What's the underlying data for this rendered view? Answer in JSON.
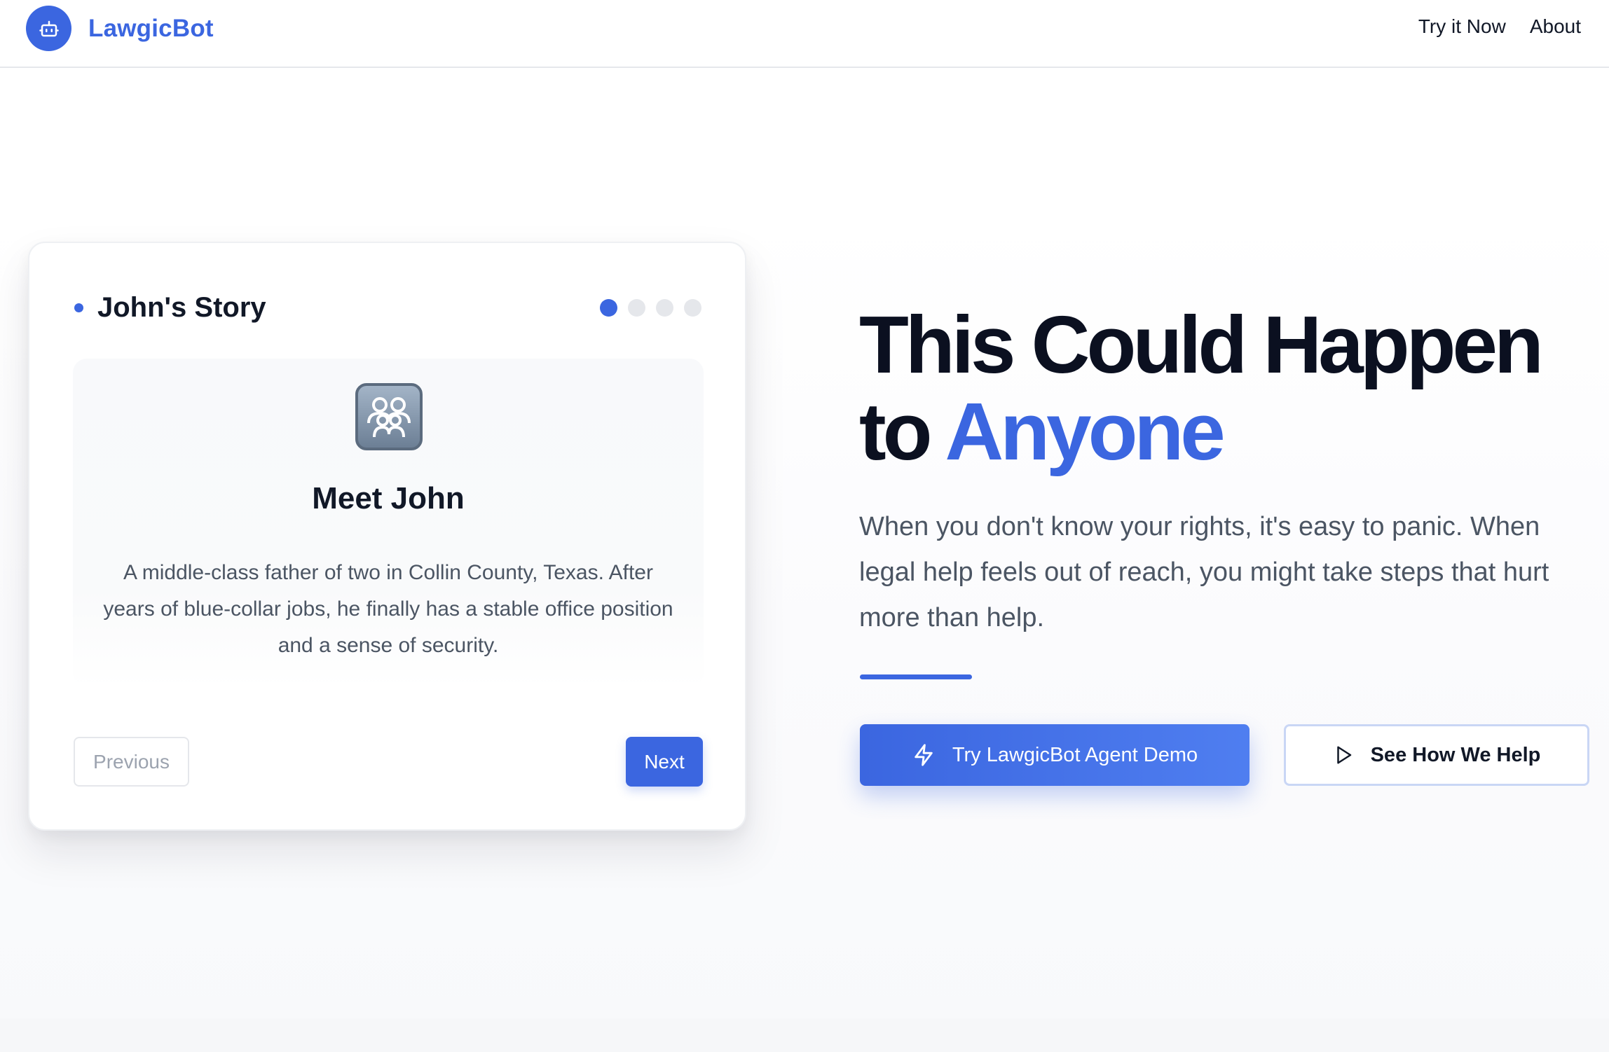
{
  "header": {
    "brand": "LawgicBot",
    "logo_icon": "robot-icon",
    "nav": [
      {
        "label": "Try it Now"
      },
      {
        "label": "About"
      }
    ]
  },
  "story_card": {
    "title": "John's Story",
    "pager": {
      "total": 4,
      "current": 1
    },
    "icon": "family-icon",
    "heading": "Meet John",
    "text": "A middle-class father of two in Collin County, Texas. After years of blue-collar jobs, he finally has a stable office position and a sense of security.",
    "prev_label": "Previous",
    "next_label": "Next"
  },
  "hero": {
    "title_line1": "This Could Happen",
    "title_line2_prefix": "to ",
    "title_accent": "Anyone",
    "subtitle": "When you don't know your rights, it's easy to panic. When legal help feels out of reach, you might take steps that hurt more than help.",
    "primary_button": {
      "label": "Try LawgicBot Agent Demo",
      "icon": "lightning-icon"
    },
    "secondary_button": {
      "label": "See How We Help",
      "icon": "play-icon"
    }
  },
  "colors": {
    "accent": "#3b66e0",
    "text": "#111827",
    "muted": "#4b5563"
  }
}
